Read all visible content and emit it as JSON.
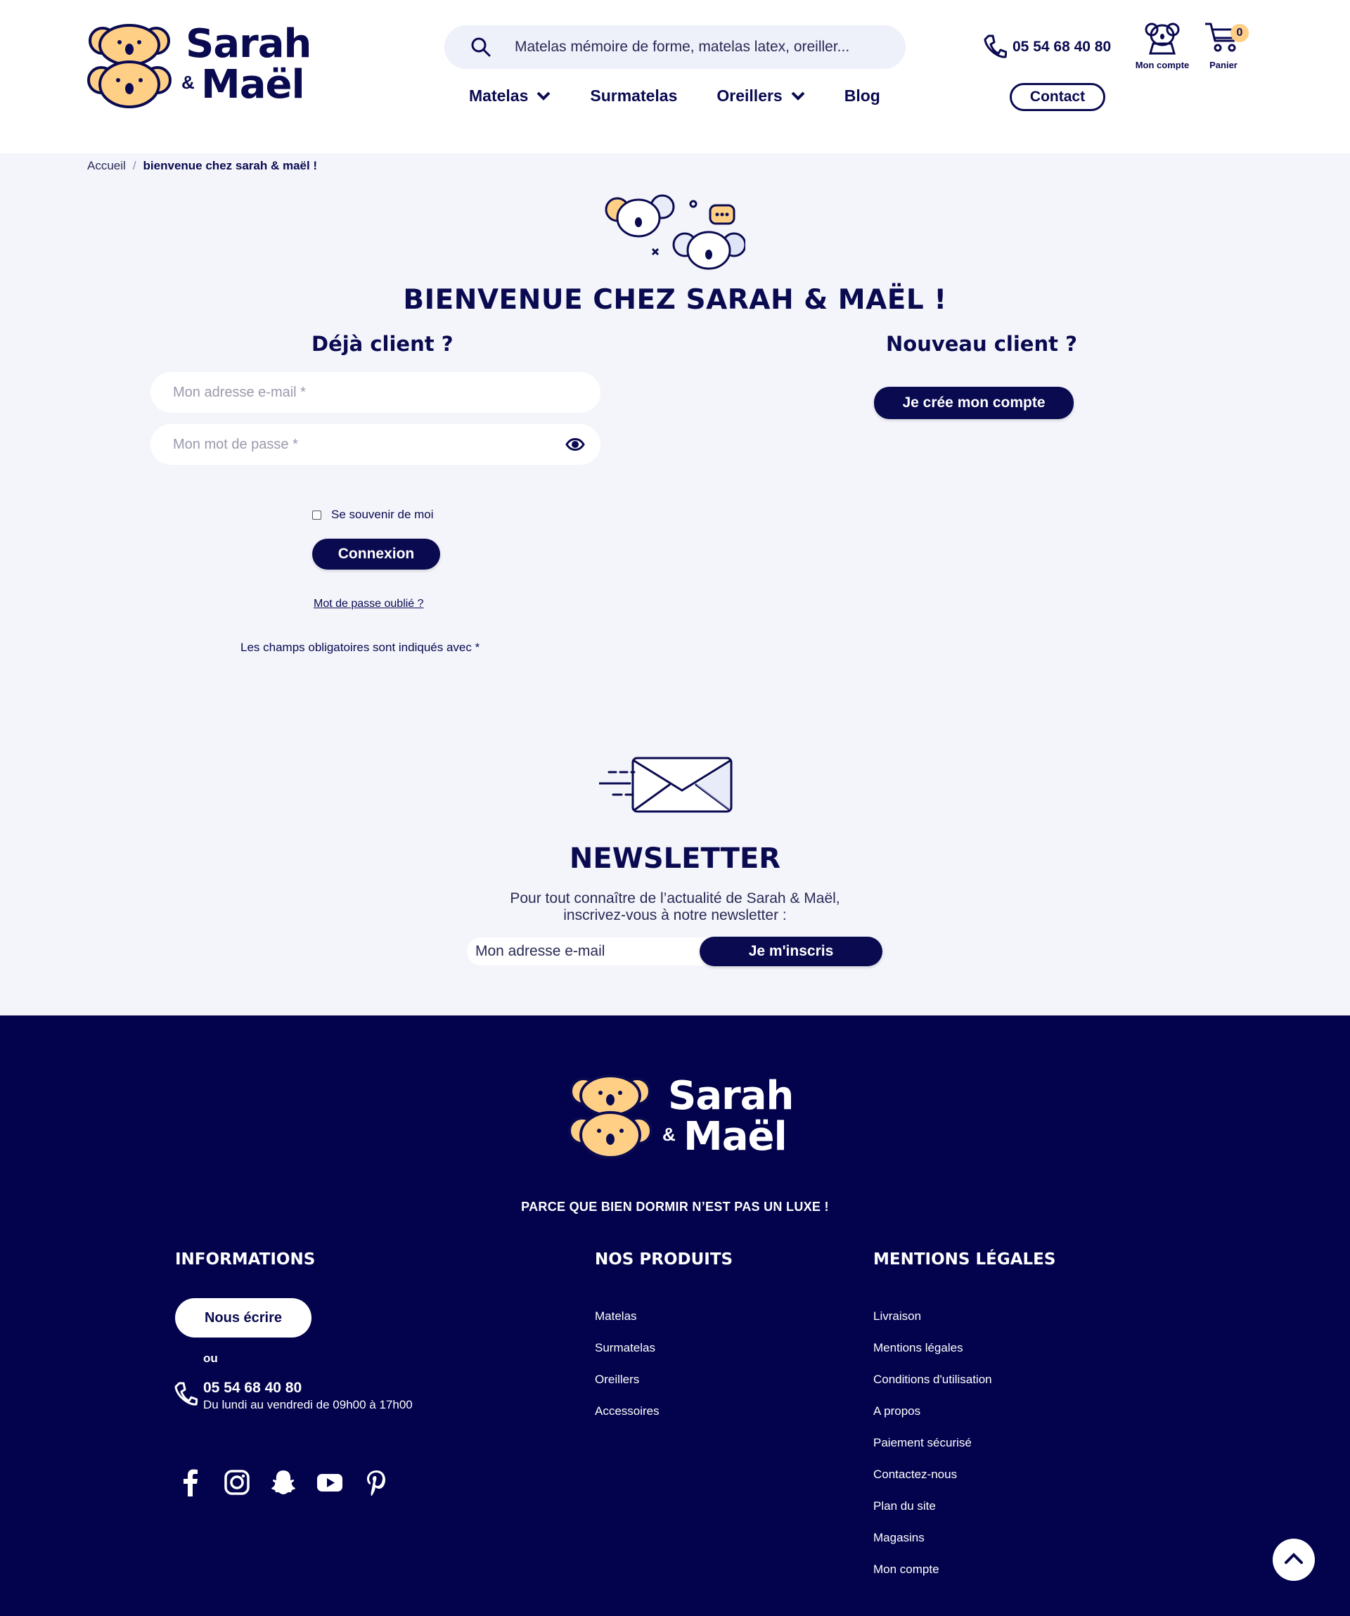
{
  "header": {
    "logo": {
      "line1": "Sarah",
      "amp": "&",
      "line2": "Maël"
    },
    "search": {
      "placeholder": "Matelas mémoire de forme, matelas latex, oreiller..."
    },
    "nav": [
      {
        "label": "Matelas",
        "has_dropdown": true
      },
      {
        "label": "Surmatelas",
        "has_dropdown": false
      },
      {
        "label": "Oreillers",
        "has_dropdown": true
      },
      {
        "label": "Blog",
        "has_dropdown": false
      }
    ],
    "phone": "05 54 68 40 80",
    "account_label": "Mon compte",
    "cart_label": "Panier",
    "cart_count": "0",
    "contact_label": "Contact"
  },
  "breadcrumb": {
    "home": "Accueil",
    "separator": "/",
    "current": "bienvenue chez sarah & maël !"
  },
  "welcome": {
    "title": "BIENVENUE CHEZ SARAH & MAËL !",
    "existing": {
      "title": "Déjà client ?",
      "email_placeholder": "Mon adresse e-mail *",
      "password_placeholder": "Mon mot de passe *",
      "remember_label": "Se souvenir de moi",
      "remember_checked": false,
      "login_label": "Connexion",
      "forgot_label": "Mot de passe oublié ?",
      "mandatory_note": "Les champs obligatoires sont indiqués avec *"
    },
    "new": {
      "title": "Nouveau client ?",
      "create_label": "Je crée mon compte"
    }
  },
  "newsletter": {
    "title": "NEWSLETTER",
    "text_line1": "Pour tout connaître de l’actualité de Sarah & Maël,",
    "text_line2": "inscrivez-vous à notre newsletter :",
    "email_placeholder": "Mon adresse e-mail",
    "submit_label": "Je m'inscris"
  },
  "footer": {
    "logo": {
      "line1": "Sarah",
      "amp": "&",
      "line2": "Maël"
    },
    "tagline": "PARCE QUE BIEN DORMIR N’EST PAS UN LUXE !",
    "informations": {
      "title": "INFORMATIONS",
      "write_label": "Nous écrire",
      "or_label": "ou",
      "phone": "05 54 68 40 80",
      "hours": "Du lundi au vendredi de 09h00 à 17h00",
      "socials": [
        "facebook-icon",
        "instagram-icon",
        "snapchat-icon",
        "youtube-icon",
        "pinterest-icon"
      ]
    },
    "produits": {
      "title": "NOS PRODUITS",
      "items": [
        "Matelas",
        "Surmatelas",
        "Oreillers",
        "Accessoires"
      ]
    },
    "mentions": {
      "title": "MENTIONS LÉGALES",
      "items": [
        "Livraison",
        "Mentions légales",
        "Conditions d'utilisation",
        "A propos",
        "Paiement sécurisé",
        "Contactez-nous",
        "Plan du site",
        "Magasins",
        "Mon compte"
      ]
    }
  },
  "colors": {
    "navy": "#0a0a50",
    "footer_bg": "#03034d",
    "page_bg": "#f4f5fb",
    "koala_fill": "#ffcf86",
    "badge": "#ffcf86"
  }
}
